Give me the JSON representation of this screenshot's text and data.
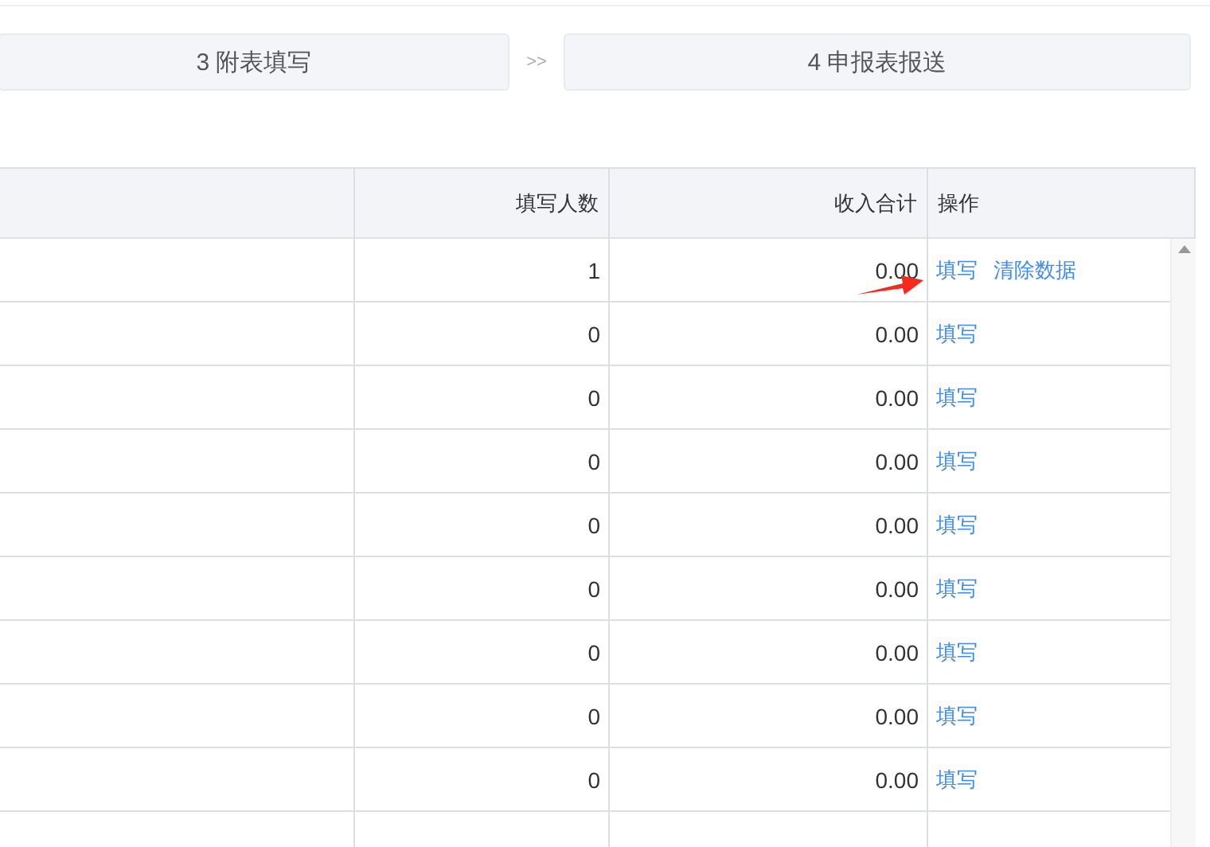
{
  "steps": [
    {
      "label": "3 附表填写"
    },
    {
      "label": "4 申报表报送"
    }
  ],
  "step_separator": ">>",
  "table": {
    "columns": [
      "",
      "填写人数",
      "收入合计",
      "操作"
    ],
    "rows": [
      {
        "count": "1",
        "total": "0.00",
        "actions": [
          "填写",
          "清除数据"
        ]
      },
      {
        "count": "0",
        "total": "0.00",
        "actions": [
          "填写"
        ]
      },
      {
        "count": "0",
        "total": "0.00",
        "actions": [
          "填写"
        ]
      },
      {
        "count": "0",
        "total": "0.00",
        "actions": [
          "填写"
        ]
      },
      {
        "count": "0",
        "total": "0.00",
        "actions": [
          "填写"
        ]
      },
      {
        "count": "0",
        "total": "0.00",
        "actions": [
          "填写"
        ]
      },
      {
        "count": "0",
        "total": "0.00",
        "actions": [
          "填写"
        ]
      },
      {
        "count": "0",
        "total": "0.00",
        "actions": [
          "填写"
        ]
      },
      {
        "count": "0",
        "total": "0.00",
        "actions": [
          "填写"
        ]
      }
    ]
  }
}
